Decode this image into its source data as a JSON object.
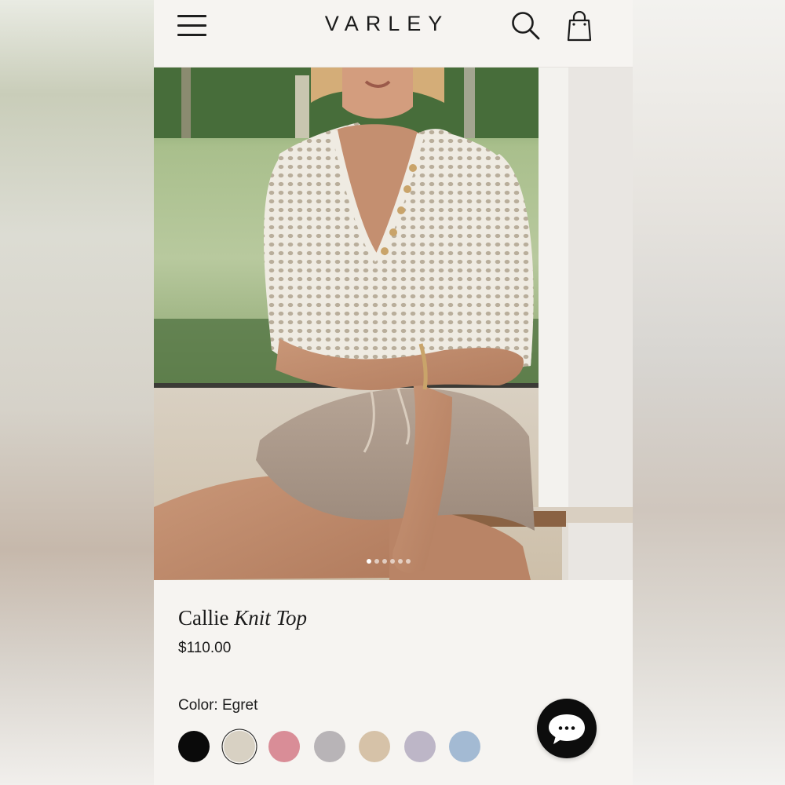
{
  "header": {
    "brand": "VARLEY",
    "menu_icon": "hamburger-menu-icon",
    "search_icon": "search-icon",
    "cart_icon": "shopping-bag-icon"
  },
  "hero": {
    "image_count": 6,
    "active_image": 1
  },
  "product": {
    "name_regular": "Callie",
    "name_italic": "Knit Top",
    "price": "$110.00",
    "color_label": "Color: Egret",
    "swatches": [
      {
        "color": "#0a0a0a",
        "selected": false
      },
      {
        "color": "#d8d1c3",
        "selected": true
      },
      {
        "color": "#d98d97",
        "selected": false
      },
      {
        "color": "#b8b4b7",
        "selected": false
      },
      {
        "color": "#d6c2a8",
        "selected": false
      },
      {
        "color": "#bdb6c7",
        "selected": false
      },
      {
        "color": "#a3bad3",
        "selected": false
      }
    ]
  },
  "chat": {
    "icon": "chat-bubble-icon"
  },
  "colors": {
    "page_bg": "#f6f4f1",
    "text": "#1b1b1b",
    "chat_button": "#0d0d0d"
  }
}
